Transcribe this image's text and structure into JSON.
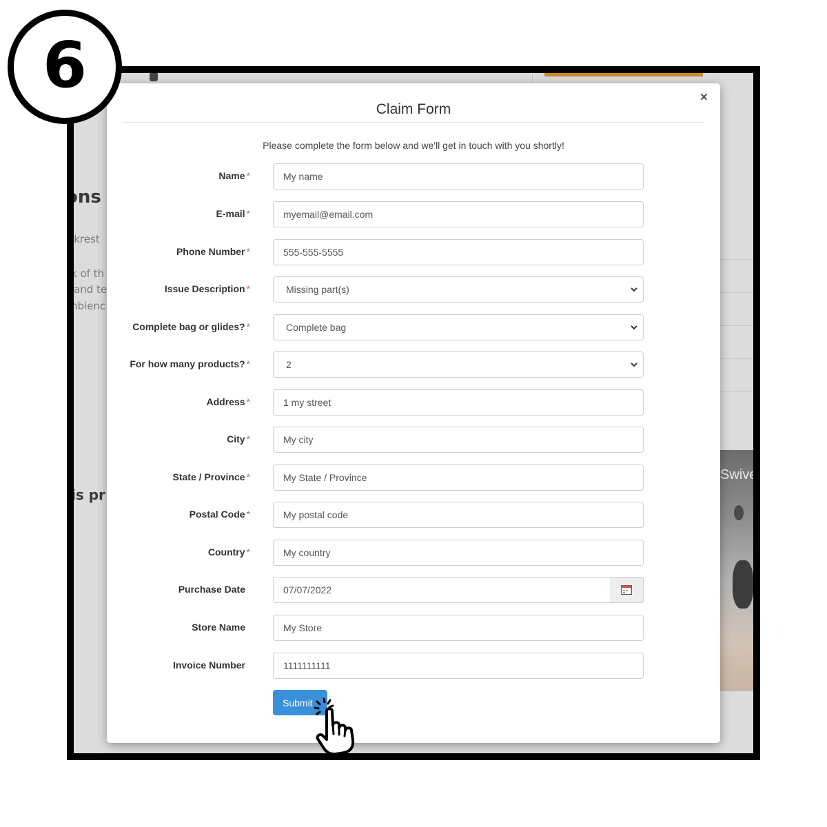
{
  "step_number": "6",
  "background": {
    "heading_fragment": "ons",
    "heading2_fragment": "is pr",
    "text_lines": [
      "ckrest",
      "k of th",
      "and te",
      "nbienc"
    ],
    "photo_caption_fragment": "Swive",
    "accent_color": "#c98a2a"
  },
  "modal": {
    "close_label": "×",
    "title": "Claim Form",
    "intro": "Please complete the form below and we'll get in touch with you shortly!",
    "required_marker": "*",
    "fields": {
      "name": {
        "label": "Name",
        "value": "My name"
      },
      "email": {
        "label": "E-mail",
        "value": "myemail@email.com"
      },
      "phone": {
        "label": "Phone Number",
        "value": "555-555-5555"
      },
      "issue": {
        "label": "Issue Description",
        "value": "Missing part(s)"
      },
      "bag": {
        "label": "Complete bag or glides?",
        "value": "Complete bag"
      },
      "count": {
        "label": "For how many products?",
        "value": "2"
      },
      "address": {
        "label": "Address",
        "value": "1 my street"
      },
      "city": {
        "label": "City",
        "value": "My city"
      },
      "state": {
        "label": "State / Province",
        "value": "My State / Province"
      },
      "postal": {
        "label": "Postal Code",
        "value": "My postal code"
      },
      "country": {
        "label": "Country",
        "value": "My country"
      },
      "purchase_date": {
        "label": "Purchase Date",
        "value": "07/07/2022"
      },
      "store": {
        "label": "Store Name",
        "value": "My Store"
      },
      "invoice": {
        "label": "Invoice Number",
        "value": "1111111111"
      }
    },
    "submit_label": "Submit",
    "submit_color": "#3a8fd9",
    "required_color": "#e05555"
  },
  "icons": {
    "close": "close-icon",
    "select_arrow": "chevron-down-icon",
    "calendar": "calendar-icon",
    "cursor": "hand-pointer-icon"
  }
}
